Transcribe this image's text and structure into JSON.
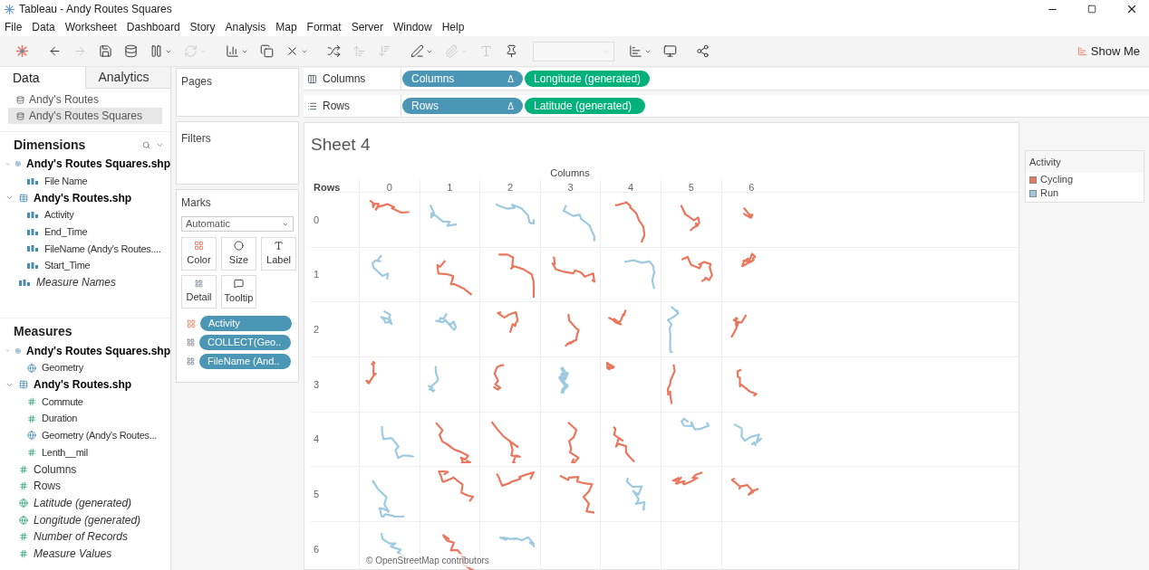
{
  "window": {
    "title": "Tableau - Andy Routes Squares"
  },
  "menu": [
    "File",
    "Data",
    "Worksheet",
    "Dashboard",
    "Story",
    "Analysis",
    "Map",
    "Format",
    "Server",
    "Window",
    "Help"
  ],
  "toolbar": [
    {
      "kind": "back",
      "disabled": false,
      "has_menu": false
    },
    {
      "kind": "forward",
      "disabled": true,
      "has_menu": false
    },
    {
      "kind": "save",
      "disabled": false,
      "has_menu": false
    },
    {
      "kind": "new-source",
      "disabled": false,
      "has_menu": false
    },
    {
      "kind": "pause",
      "disabled": false,
      "has_menu": true
    },
    {
      "kind": "refresh",
      "disabled": true,
      "has_menu": true
    },
    {
      "kind": "new-sheet",
      "disabled": false,
      "has_menu": true
    },
    {
      "kind": "duplicate",
      "disabled": false,
      "has_menu": false
    },
    {
      "kind": "clear",
      "disabled": false,
      "has_menu": true
    },
    {
      "kind": "swap",
      "disabled": false,
      "has_menu": false
    },
    {
      "kind": "sort-asc",
      "disabled": true,
      "has_menu": false
    },
    {
      "kind": "sort-desc",
      "disabled": true,
      "has_menu": false
    },
    {
      "kind": "highlight",
      "disabled": false,
      "has_menu": true
    },
    {
      "kind": "group",
      "disabled": true,
      "has_menu": true
    },
    {
      "kind": "labels",
      "disabled": true,
      "has_menu": false
    },
    {
      "kind": "pin",
      "disabled": false,
      "has_menu": false
    },
    {
      "kind": "cards",
      "disabled": false,
      "has_menu": true
    },
    {
      "kind": "presentation",
      "disabled": false,
      "has_menu": false
    },
    {
      "kind": "share",
      "disabled": false,
      "has_menu": false
    }
  ],
  "show_me": "Show Me",
  "side_tabs": [
    {
      "label": "Data",
      "selected": true
    },
    {
      "label": "Analytics",
      "selected": false
    }
  ],
  "data_sources": [
    {
      "label": "Andy's Routes",
      "selected": false
    },
    {
      "label": "Andy's Routes Squares",
      "selected": true
    }
  ],
  "dimensions": {
    "title": "Dimensions",
    "items": [
      {
        "label": "Andy's Routes Squares.shp",
        "kind": "table",
        "expanded": true,
        "children": [
          {
            "label": "File Name",
            "kind": "abc",
            "italic": false
          }
        ]
      },
      {
        "label": "Andy's Routes.shp",
        "kind": "table",
        "expanded": true,
        "children": [
          {
            "label": "Activity",
            "kind": "abc",
            "italic": false
          },
          {
            "label": "End_Time",
            "kind": "abc",
            "italic": false
          },
          {
            "label": "FileName (Andy's Routes....",
            "kind": "abc",
            "italic": false
          },
          {
            "label": "Start_Time",
            "kind": "abc",
            "italic": false
          }
        ]
      },
      {
        "label": "Measure Names",
        "kind": "abc",
        "italic": true
      }
    ]
  },
  "measures": {
    "title": "Measures",
    "items": [
      {
        "label": "Andy's Routes Squares.shp",
        "kind": "table",
        "expanded": true,
        "children": [
          {
            "label": "Geometry",
            "kind": "geo",
            "italic": false
          }
        ]
      },
      {
        "label": "Andy's Routes.shp",
        "kind": "table",
        "expanded": true,
        "children": [
          {
            "label": "Commute",
            "kind": "number",
            "italic": false
          },
          {
            "label": "Duration",
            "kind": "number",
            "italic": false
          },
          {
            "label": "Geometry (Andy's Routes...",
            "kind": "geo",
            "italic": false
          },
          {
            "label": "Lenth__mil",
            "kind": "number",
            "italic": false
          }
        ]
      },
      {
        "label": "Columns",
        "kind": "bin",
        "italic": false
      },
      {
        "label": "Rows",
        "kind": "bin",
        "italic": false
      },
      {
        "label": "Latitude (generated)",
        "kind": "globe",
        "italic": true
      },
      {
        "label": "Longitude (generated)",
        "kind": "globe",
        "italic": true
      },
      {
        "label": "Number of Records",
        "kind": "bin",
        "italic": true
      },
      {
        "label": "Measure Values",
        "kind": "number",
        "italic": true
      }
    ]
  },
  "pages": {
    "title": "Pages"
  },
  "filters": {
    "title": "Filters"
  },
  "marks": {
    "title": "Marks",
    "mark_type": "Automatic",
    "cards": [
      {
        "label": "Color",
        "kind": "color"
      },
      {
        "label": "Size",
        "kind": "size"
      },
      {
        "label": "Label",
        "kind": "label"
      },
      {
        "label": "Detail",
        "kind": "detail"
      },
      {
        "label": "Tooltip",
        "kind": "tooltip"
      }
    ],
    "pills": [
      {
        "label": "Activity",
        "kind": "color"
      },
      {
        "label": "COLLECT(Geo..",
        "kind": "detail"
      },
      {
        "label": "FileName (And..",
        "kind": "detail"
      }
    ]
  },
  "columns_shelf": {
    "label": "Columns",
    "kind": "columns",
    "pills": [
      {
        "label": "Columns",
        "kind": "dimension",
        "delta": "Δ"
      },
      {
        "label": "Longitude (generated)",
        "kind": "measure"
      }
    ]
  },
  "rows_shelf": {
    "label": "Rows",
    "kind": "rows",
    "pills": [
      {
        "label": "Rows",
        "kind": "dimension",
        "delta": "Δ"
      },
      {
        "label": "Latitude (generated)",
        "kind": "measure"
      }
    ]
  },
  "sheet": {
    "title": "Sheet 4",
    "column_header": "Columns",
    "row_header": "Rows",
    "columns": [
      "0",
      "1",
      "2",
      "3",
      "4",
      "5",
      "6"
    ],
    "rows": [
      {
        "label": "0",
        "cells": [
          {
            "kind": "cycling"
          },
          {
            "kind": "run"
          },
          {
            "kind": "run"
          },
          {
            "kind": "run"
          },
          {
            "kind": "cycling"
          },
          {
            "kind": "cycling"
          },
          {
            "kind": "cycling"
          }
        ]
      },
      {
        "label": "1",
        "cells": [
          {
            "kind": "run"
          },
          {
            "kind": "cycling"
          },
          {
            "kind": "cycling"
          },
          {
            "kind": "cycling"
          },
          {
            "kind": "run"
          },
          {
            "kind": "cycling"
          },
          {
            "kind": "cycling"
          }
        ]
      },
      {
        "label": "2",
        "cells": [
          {
            "kind": "run"
          },
          {
            "kind": "run"
          },
          {
            "kind": "cycling"
          },
          {
            "kind": "cycling"
          },
          {
            "kind": "cycling"
          },
          {
            "kind": "run"
          },
          {
            "kind": "cycling"
          }
        ]
      },
      {
        "label": "3",
        "cells": [
          {
            "kind": "cycling"
          },
          {
            "kind": "run"
          },
          {
            "kind": "cycling"
          },
          {
            "kind": "run"
          },
          {
            "kind": "cycling"
          },
          {
            "kind": "cycling"
          },
          {
            "kind": "cycling"
          }
        ]
      },
      {
        "label": "4",
        "cells": [
          {
            "kind": "run"
          },
          {
            "kind": "cycling"
          },
          {
            "kind": "cycling"
          },
          {
            "kind": "cycling"
          },
          {
            "kind": "cycling"
          },
          {
            "kind": "run"
          },
          {
            "kind": "run"
          }
        ]
      },
      {
        "label": "5",
        "cells": [
          {
            "kind": "run"
          },
          {
            "kind": "cycling"
          },
          {
            "kind": "cycling"
          },
          {
            "kind": "cycling"
          },
          {
            "kind": "run"
          },
          {
            "kind": "cycling"
          },
          {
            "kind": "cycling"
          }
        ]
      },
      {
        "label": "6",
        "cells": [
          {
            "kind": "run"
          },
          {
            "kind": "cycling"
          },
          {
            "kind": "run"
          }
        ]
      }
    ],
    "attribution": "© OpenStreetMap contributors"
  },
  "legend": {
    "title": "Activity",
    "items": [
      {
        "kind": "cycling",
        "label": "Cycling",
        "color": "#e8775e"
      },
      {
        "kind": "run",
        "label": "Run",
        "color": "#9ecae1"
      }
    ]
  }
}
